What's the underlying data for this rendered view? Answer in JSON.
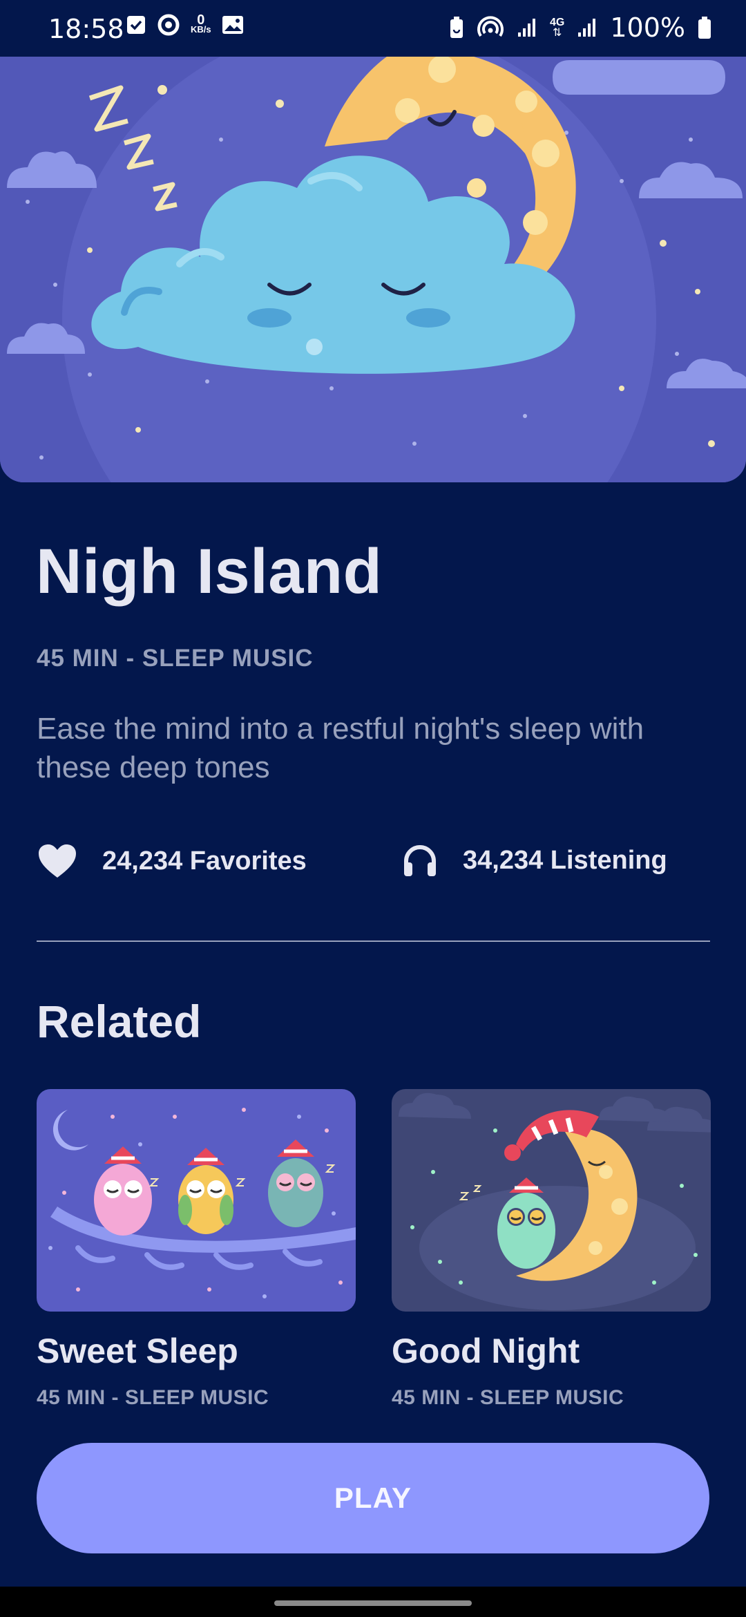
{
  "status_bar": {
    "time": "18:58",
    "net_speed_value": "0",
    "net_speed_unit": "KB/s",
    "network_type": "4G",
    "battery": "100%",
    "left_icons": [
      "check-icon",
      "sync-icon",
      "net-speed-icon",
      "image-icon"
    ],
    "right_icons": [
      "battery-saver-icon",
      "hotspot-icon",
      "signal-icon",
      "signal-icon",
      "battery-icon"
    ]
  },
  "hero": {
    "image": "sleeping-cloud-moon-illustration"
  },
  "track": {
    "title": "Nigh Island",
    "subtitle": "45 MIN - SLEEP MUSIC",
    "description": "Ease the mind into a restful night's sleep with these deep tones"
  },
  "stats": {
    "favorites": {
      "icon": "heart-icon",
      "label": "24,234 Favorites"
    },
    "listening": {
      "icon": "headphones-icon",
      "label": "34,234 Listening"
    }
  },
  "related": {
    "heading": "Related",
    "items": [
      {
        "title": "Sweet Sleep",
        "subtitle": "45 MIN - SLEEP MUSIC",
        "image": "owls-on-branch-illustration"
      },
      {
        "title": "Good Night",
        "subtitle": "45 MIN - SLEEP MUSIC",
        "image": "owl-on-moon-illustration"
      }
    ]
  },
  "play_button": {
    "label": "PLAY"
  },
  "colors": {
    "background": "#03174C",
    "accent": "#8E97FE",
    "text_primary": "#E6E7F2",
    "text_secondary": "#98A1BC"
  }
}
